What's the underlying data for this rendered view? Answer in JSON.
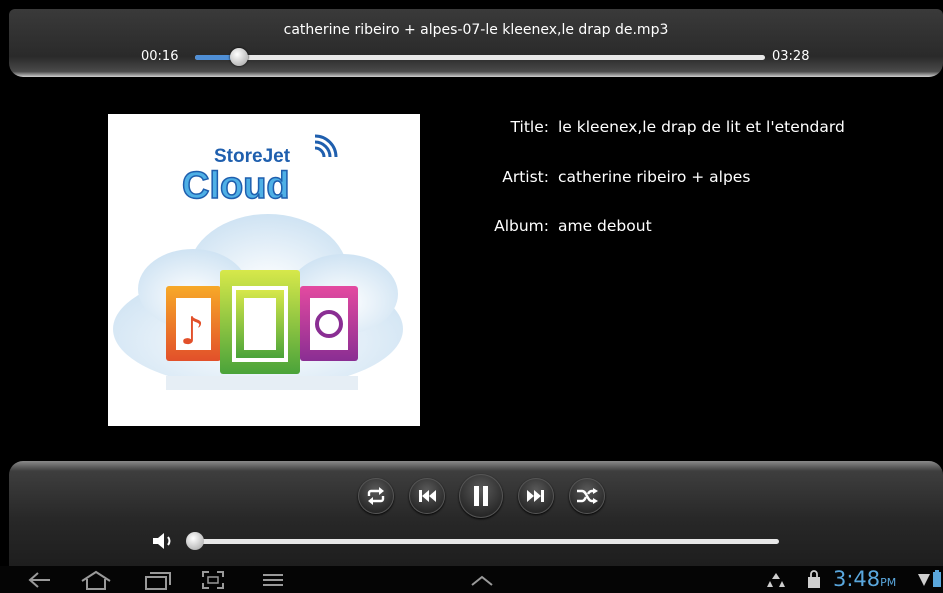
{
  "player": {
    "file_name": "catherine ribeiro + alpes-07-le kleenex,le drap de.mp3",
    "current_time": "00:16",
    "total_time": "03:28",
    "progress_fraction": 0.077,
    "volume_fraction": 0.0
  },
  "album_art": {
    "brand_line1": "StoreJet",
    "brand_line2": "Cloud"
  },
  "metadata": {
    "title_label": "Title:",
    "title_value": "le kleenex,le drap de lit et l'etendard",
    "artist_label": "Artist:",
    "artist_value": "catherine ribeiro + alpes",
    "album_label": "Album:",
    "album_value": "ame debout"
  },
  "controls": [
    {
      "name": "repeat-button",
      "icon": "repeat-icon"
    },
    {
      "name": "previous-button",
      "icon": "skip-previous-icon"
    },
    {
      "name": "pause-button",
      "icon": "pause-icon"
    },
    {
      "name": "next-button",
      "icon": "skip-next-icon"
    },
    {
      "name": "shuffle-button",
      "icon": "shuffle-icon"
    }
  ],
  "system_bar": {
    "time": "3:48",
    "ampm": "PM",
    "icons": [
      "back-icon",
      "home-icon",
      "recent-apps-icon",
      "screenshot-icon",
      "menu-icon",
      "chevron-up-icon",
      "recycle-icon",
      "shopping-bag-icon",
      "wifi-icon",
      "battery-icon"
    ]
  },
  "colors": {
    "accent": "#4f8fd6",
    "clock": "#5aa7dd"
  }
}
